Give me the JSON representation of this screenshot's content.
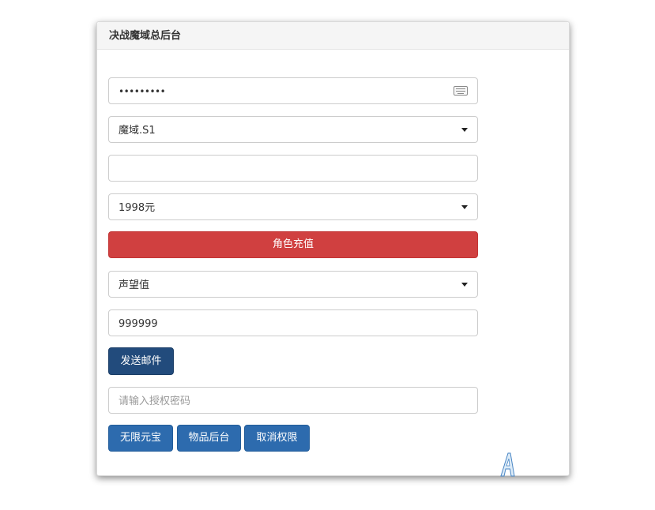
{
  "panel": {
    "title": "决战魔域总后台"
  },
  "form": {
    "password_value": "•••••••••",
    "server_select": "魔域.S1",
    "text_input_value": "",
    "amount_select": "1998元",
    "recharge_button": "角色充值",
    "attribute_select": "声望值",
    "quantity_value": "999999",
    "send_mail_button": "发送邮件",
    "auth_placeholder": "请输入授权密码"
  },
  "actions": {
    "unlimited_button": "无限元宝",
    "items_button": "物品后台",
    "revoke_button": "取消权限"
  },
  "icons": {
    "keyboard": "keyboard-icon",
    "dropdown": "caret-down-icon"
  },
  "colors": {
    "danger": "#d04040",
    "dark_blue": "#224b7c",
    "primary": "#2d6bae"
  }
}
